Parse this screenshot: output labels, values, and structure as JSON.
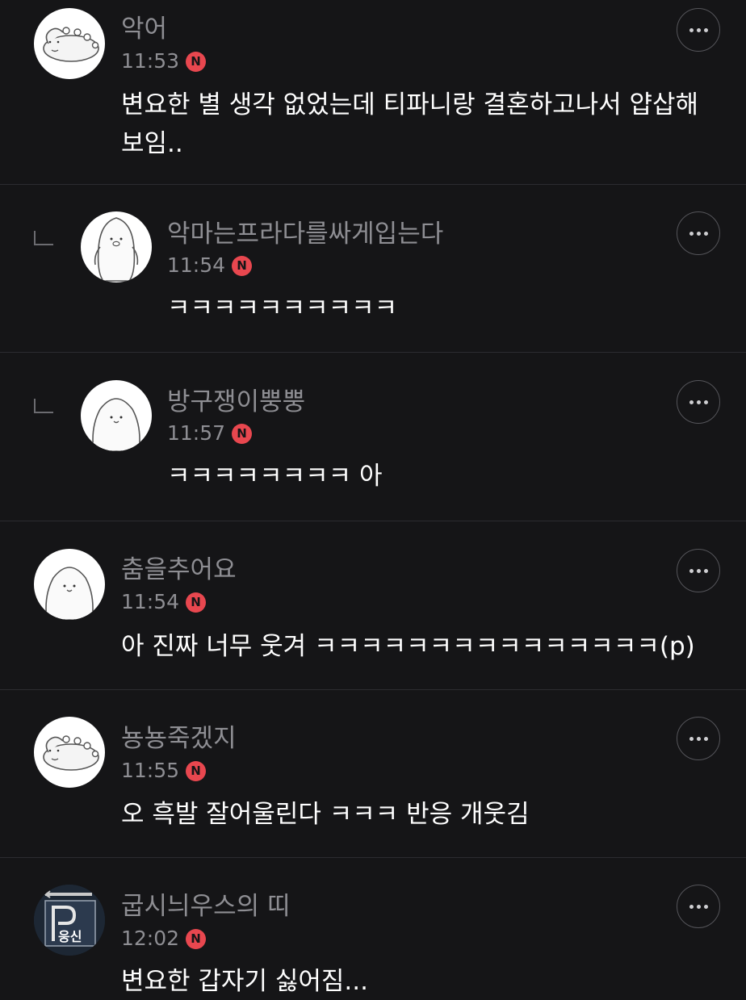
{
  "comments": [
    {
      "username": "악어",
      "time": "11:53",
      "badge": "N",
      "text_lines": [
        "변요한 별 생각 없었는데 티파니랑 결혼하고나서 얍삽해",
        "보임.."
      ],
      "reply": false,
      "avatar": "dino-avatar"
    },
    {
      "username": "악마는프라다를싸게입는다",
      "time": "11:54",
      "badge": "N",
      "text_lines": [
        "ㅋㅋㅋㅋㅋㅋㅋㅋㅋㅋ"
      ],
      "reply": true,
      "avatar": "penguin-avatar"
    },
    {
      "username": "방구쟁이뿡뿡",
      "time": "11:57",
      "badge": "N",
      "text_lines": [
        "ㅋㅋㅋㅋㅋㅋㅋㅋ 아"
      ],
      "reply": true,
      "avatar": "ghost-avatar"
    },
    {
      "username": "춤을추어요",
      "time": "11:54",
      "badge": "N",
      "text_lines": [
        "아 진짜 너무 웃겨 ㅋㅋㅋㅋㅋㅋㅋㅋㅋㅋㅋㅋㅋㅋㅋ(p)"
      ],
      "reply": false,
      "avatar": "ghost-avatar"
    },
    {
      "username": "뇽뇽죽겠지",
      "time": "11:55",
      "badge": "N",
      "text_lines": [
        "오 흑발 잘어울린다 ㅋㅋㅋ 반응 개웃김"
      ],
      "reply": false,
      "avatar": "dino-avatar"
    },
    {
      "username": "굽시늬우스의 띠",
      "time": "12:02",
      "badge": "N",
      "text_lines": [
        "변요한 갑자기 싫어짐..."
      ],
      "reply": false,
      "avatar": "sign-avatar",
      "avatar_text": "웅신"
    }
  ]
}
